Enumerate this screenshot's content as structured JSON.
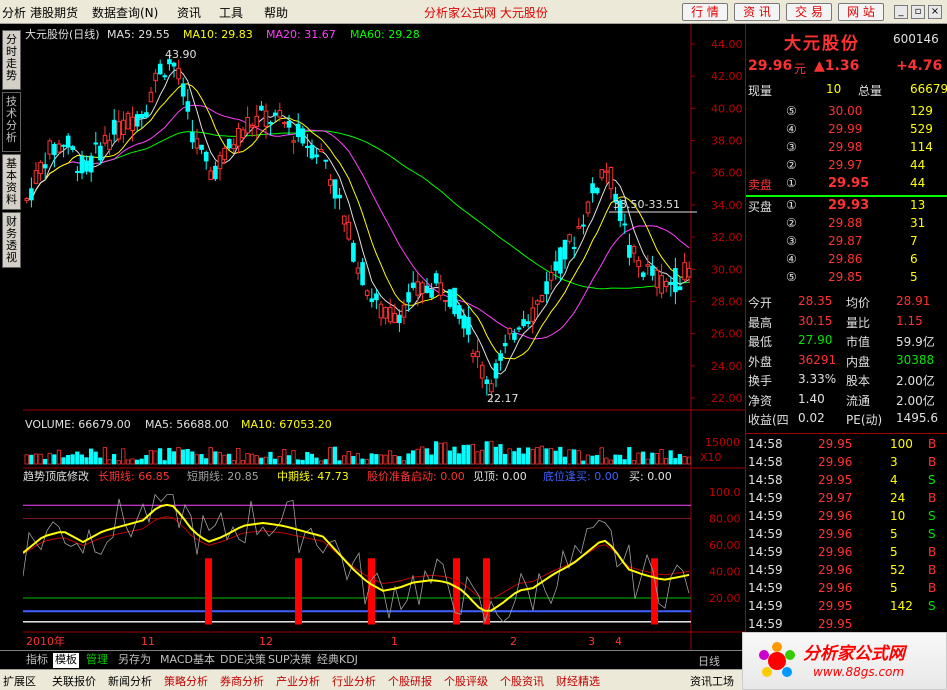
{
  "menu": {
    "items": [
      "分析",
      "港股期货",
      "数据查询(N)",
      "资讯",
      "工具",
      "帮助"
    ],
    "title": "分析家公式网 大元股份",
    "buttons": [
      "行 情",
      "资 讯",
      "交 易",
      "网 站"
    ]
  },
  "vtabs": [
    "分时走势",
    "技术分析",
    "基本资料",
    "财务透视"
  ],
  "chart": {
    "title": "大元股份(日线)",
    "ma_labels": [
      "MA5: 29.55",
      "MA10: 29.83",
      "MA20: 31.67",
      "MA60: 29.28"
    ],
    "price_axis": [
      "44.00",
      "42.00",
      "40.00",
      "38.00",
      "36.00",
      "34.00",
      "32.00",
      "30.00",
      "28.00",
      "26.00",
      "24.00",
      "22.00"
    ],
    "annot_high": "43.90",
    "annot_low": "22.17",
    "annot_range": "33.50-33.51",
    "volume_label": "VOLUME: 66679.00",
    "vol_ma5": "MA5: 56688.00",
    "vol_ma10": "MA10: 67053.20",
    "vol_axis_value": "15000",
    "vol_axis_unit": "X10",
    "ind_name": "趋势顶底修改",
    "ind_long": "长期线: 66.85",
    "ind_short": "短期线: 20.85",
    "ind_mid": "中期线: 47.73",
    "ind_prep": "股价准备启动: 0.00",
    "ind_top": "见顶: 0.00",
    "ind_bottom": "底位逢买: 0.00",
    "ind_buy": "买: 0.00",
    "ind_axis": [
      "100.0",
      "80.00",
      "60.00",
      "40.00",
      "20.00"
    ],
    "date_labels": [
      "2010年",
      "11",
      "12",
      "1",
      "2",
      "3",
      "4"
    ]
  },
  "quote": {
    "name": "大元股份",
    "code": "600146",
    "price": "29.96",
    "price_unit": "元",
    "change": "▲1.36",
    "pct": "+4.76",
    "cur_vol_label": "现量",
    "cur_vol": "10",
    "total_vol_label": "总量",
    "total_vol": "66679",
    "asks": [
      {
        "lvl": "⑤",
        "price": "30.00",
        "vol": "129"
      },
      {
        "lvl": "④",
        "price": "29.99",
        "vol": "529"
      },
      {
        "lvl": "③",
        "price": "29.98",
        "vol": "114"
      },
      {
        "lvl": "②",
        "price": "29.97",
        "vol": "44"
      },
      {
        "lvl": "①",
        "price": "29.95",
        "vol": "44",
        "label": "卖盘"
      }
    ],
    "bids": [
      {
        "lvl": "①",
        "price": "29.93",
        "vol": "13",
        "label": "买盘"
      },
      {
        "lvl": "②",
        "price": "29.88",
        "vol": "31"
      },
      {
        "lvl": "③",
        "price": "29.87",
        "vol": "7"
      },
      {
        "lvl": "④",
        "price": "29.86",
        "vol": "6"
      },
      {
        "lvl": "⑤",
        "price": "29.85",
        "vol": "5"
      }
    ],
    "stats": [
      {
        "l1": "今开",
        "v1": "28.35",
        "l2": "均价",
        "v2": "28.91"
      },
      {
        "l1": "最高",
        "v1": "30.15",
        "l2": "量比",
        "v2": "1.15"
      },
      {
        "l1": "最低",
        "v1": "27.90",
        "l2": "市值",
        "v2": "59.9亿"
      },
      {
        "l1": "外盘",
        "v1": "36291",
        "l2": "内盘",
        "v2": "30388"
      },
      {
        "l1": "换手",
        "v1": "3.33%",
        "l2": "股本",
        "v2": "2.00亿"
      },
      {
        "l1": "净资",
        "v1": "1.40",
        "l2": "流通",
        "v2": "2.00亿"
      },
      {
        "l1": "收益(四",
        "v1": "0.02",
        "l2": "PE(动)",
        "v2": "1495.6"
      }
    ],
    "ticks": [
      {
        "t": "14:58",
        "p": "29.95",
        "v": "100",
        "s": "B"
      },
      {
        "t": "14:58",
        "p": "29.96",
        "v": "3",
        "s": "B"
      },
      {
        "t": "14:58",
        "p": "29.95",
        "v": "4",
        "s": "S"
      },
      {
        "t": "14:59",
        "p": "29.97",
        "v": "24",
        "s": "B"
      },
      {
        "t": "14:59",
        "p": "29.96",
        "v": "10",
        "s": "S"
      },
      {
        "t": "14:59",
        "p": "29.96",
        "v": "5",
        "s": "S"
      },
      {
        "t": "14:59",
        "p": "29.96",
        "v": "5",
        "s": "B"
      },
      {
        "t": "14:59",
        "p": "29.96",
        "v": "52",
        "s": "B"
      },
      {
        "t": "14:59",
        "p": "29.96",
        "v": "5",
        "s": "B"
      },
      {
        "t": "14:59",
        "p": "29.95",
        "v": "142",
        "s": "S"
      },
      {
        "t": "14:59",
        "p": "29.95",
        "v": "",
        "s": ""
      },
      {
        "t": "14:59",
        "p": "",
        "v": "",
        "s": ""
      }
    ]
  },
  "bottom_tabs": [
    "指标",
    "模板",
    "管理",
    "另存为",
    "MACD基本",
    "DDE决策",
    "SUP决策",
    "经典KDJ"
  ],
  "bottom_right": "日线",
  "status_tabs": [
    "扩展区",
    "关联报价",
    "新闻分析",
    "策略分析",
    "券商分析",
    "产业分析",
    "行业分析",
    "个股研报",
    "个股评级",
    "个股资讯",
    "财经精选",
    "资讯工场"
  ],
  "logo": {
    "name": "分析家公式网",
    "url": "www.88gs.com"
  }
}
